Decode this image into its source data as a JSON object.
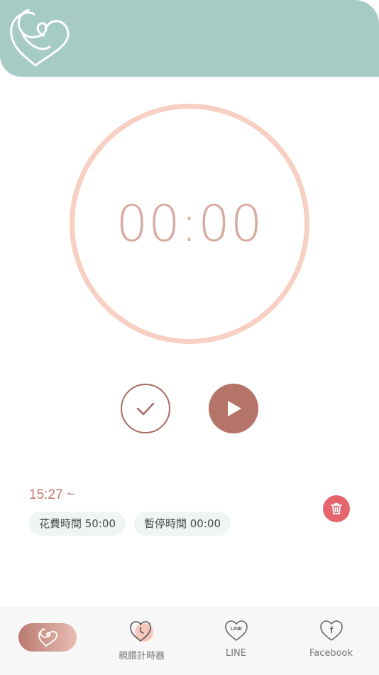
{
  "header": {
    "logo_icon": "heart-swirl-logo-icon",
    "color": "#a6cbc4"
  },
  "timer": {
    "display": "00:00",
    "ring_color": "#f7cfc3"
  },
  "controls": {
    "done_icon": "checkmark-icon",
    "play_icon": "play-icon",
    "accent": "#b47468"
  },
  "record": {
    "start_time": "15:27 ~",
    "spent_chip": "花費時間 50:00",
    "paused_chip": "暫停時間 00:00",
    "delete_icon": "trash-icon",
    "delete_color": "#e5656e"
  },
  "tabs": [
    {
      "icon": "heart-swirl-icon",
      "label": ""
    },
    {
      "icon": "heart-clock-icon",
      "label": "親餵計時器"
    },
    {
      "icon": "line-heart-icon",
      "label": "LINE"
    },
    {
      "icon": "facebook-heart-icon",
      "label": "Facebook"
    }
  ]
}
